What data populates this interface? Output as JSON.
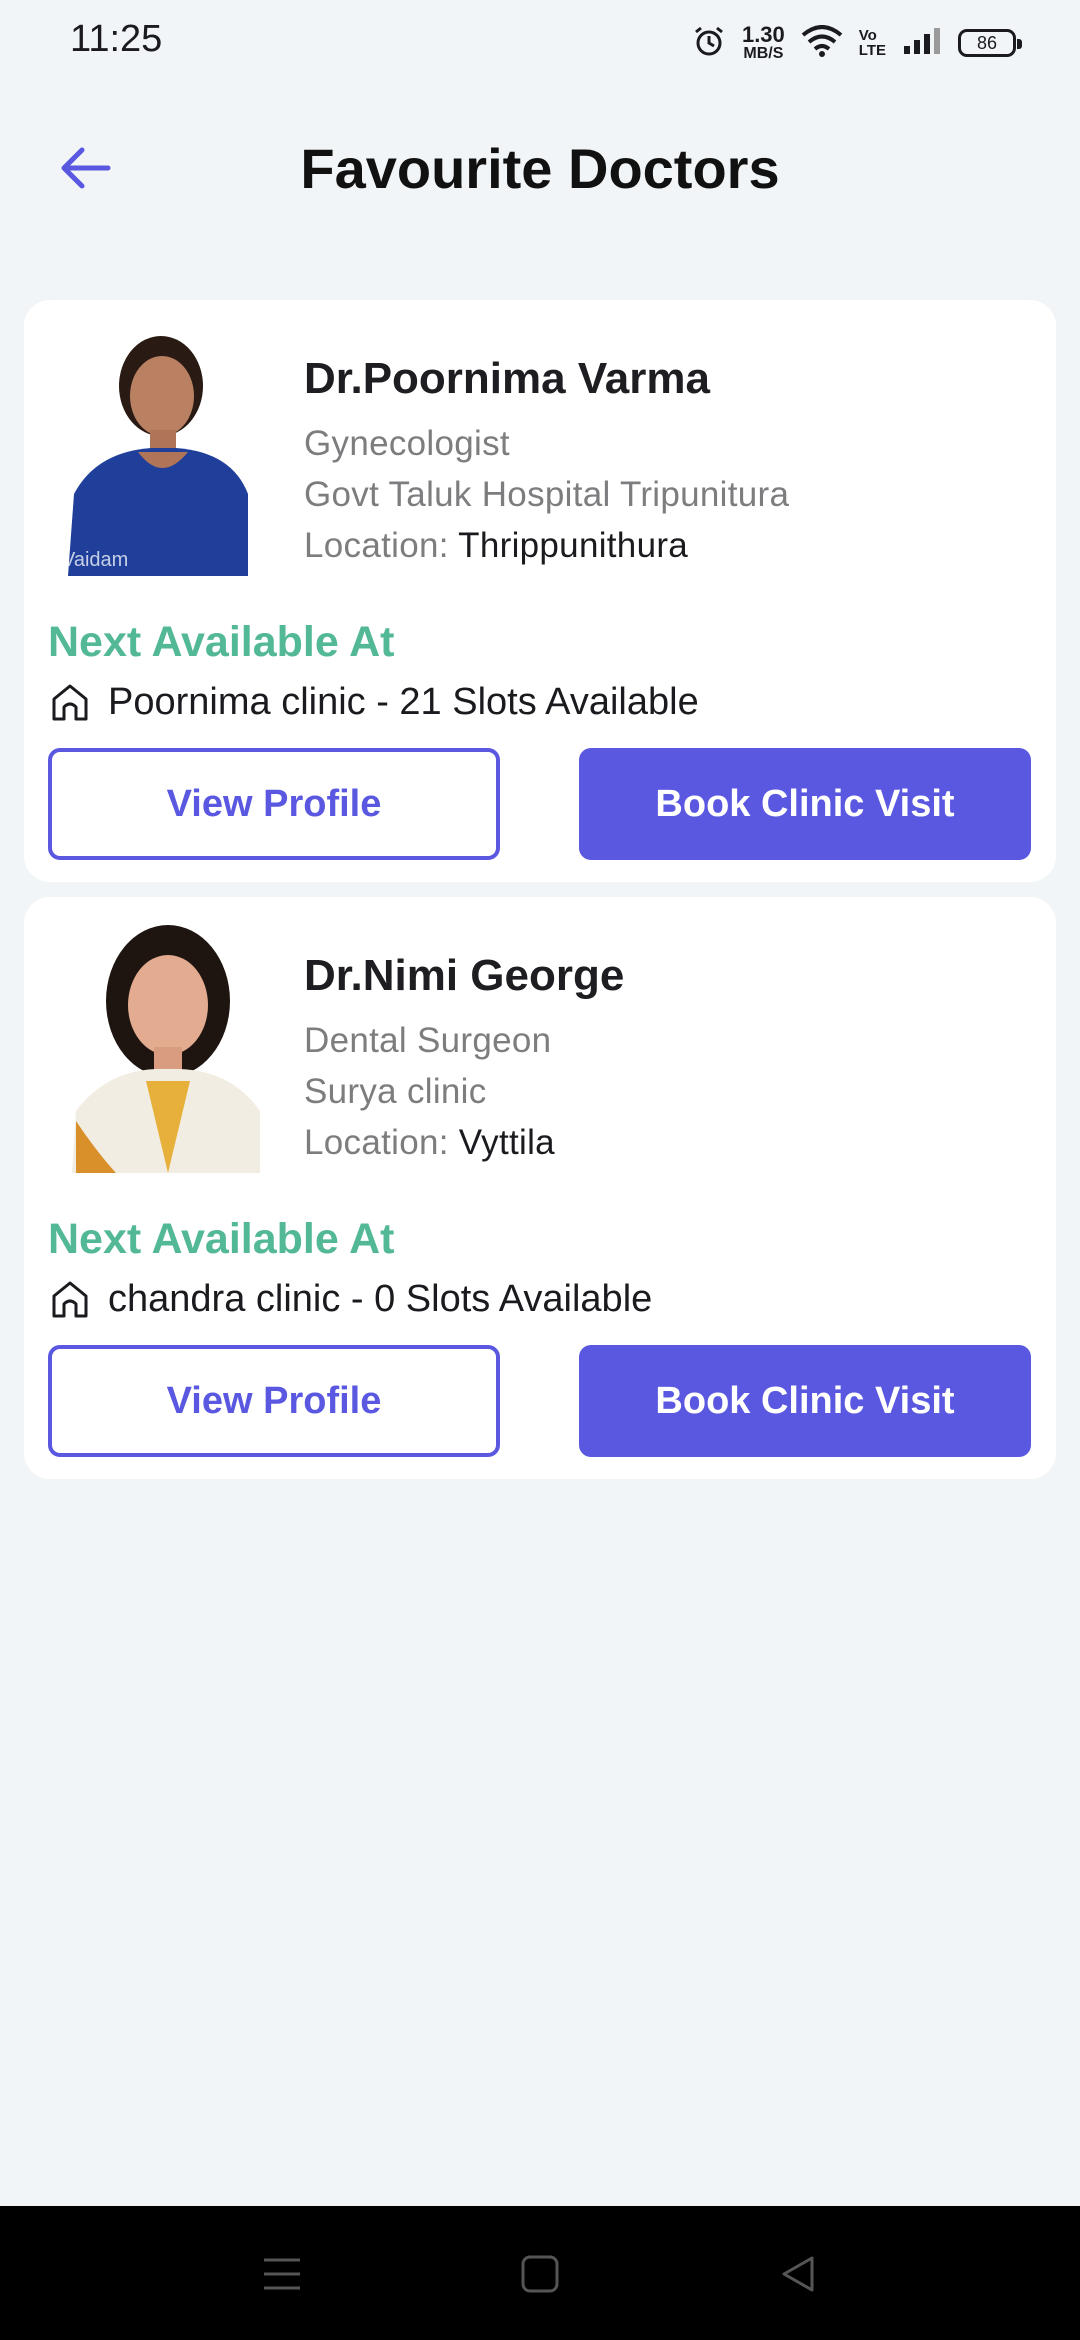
{
  "status_bar": {
    "time": "11:25",
    "net_speed_value": "1.30",
    "net_speed_unit": "MB/S",
    "volte_top": "Vo",
    "volte_bottom": "LTE",
    "battery_level": "86",
    "icons": [
      "alarm-icon",
      "wifi-icon",
      "signal-icon",
      "battery-icon"
    ]
  },
  "header": {
    "title": "Favourite Doctors",
    "back_icon": "arrow-left-icon"
  },
  "doctors": [
    {
      "name": "Dr.Poornima Varma",
      "specialty": "Gynecologist",
      "hospital": "Govt Taluk Hospital Tripunitura",
      "location_label": "Location:",
      "location_value": "Thrippunithura",
      "photo_watermark": "Vaidam",
      "next_available_label": "Next Available At",
      "clinic_text": "Poornima clinic - 21 Slots Available",
      "view_profile_label": "View Profile",
      "book_label": "Book Clinic Visit"
    },
    {
      "name": "Dr.Nimi George",
      "specialty": "Dental Surgeon",
      "hospital": "Surya clinic",
      "location_label": "Location:",
      "location_value": "Vyttila",
      "next_available_label": "Next Available At",
      "clinic_text": "chandra clinic - 0 Slots Available",
      "view_profile_label": "View Profile",
      "book_label": "Book Clinic Visit"
    }
  ],
  "colors": {
    "accent": "#5a58e0",
    "next_available": "#52b896",
    "background": "#f2f5f7"
  },
  "nav_bar": {
    "icons": [
      "menu-icon",
      "home-square-icon",
      "back-triangle-icon"
    ]
  }
}
